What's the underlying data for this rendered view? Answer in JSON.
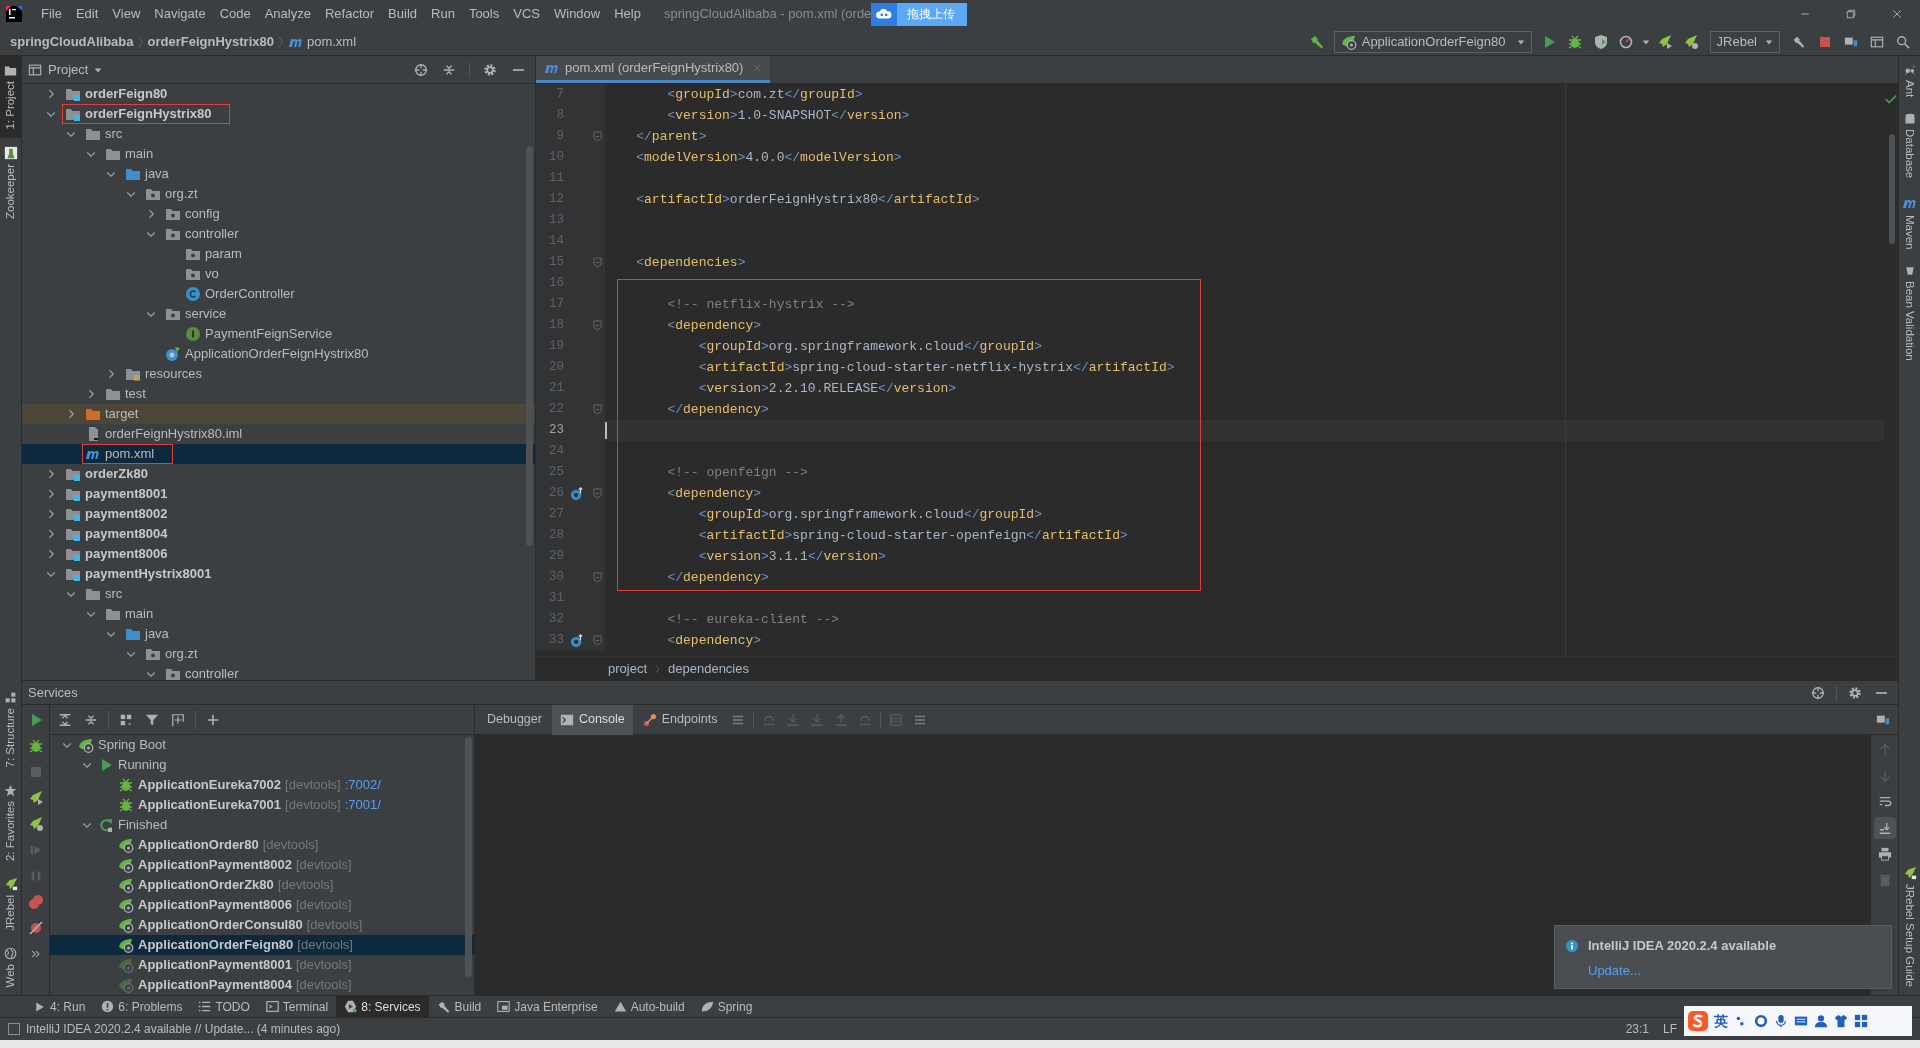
{
  "menu_bar": {
    "items": [
      "File",
      "Edit",
      "View",
      "Navigate",
      "Code",
      "Analyze",
      "Refactor",
      "Build",
      "Run",
      "Tools",
      "VCS",
      "Window",
      "Help"
    ],
    "window_title": "springCloudAlibaba - pom.xml (orde",
    "upload_button": "拖拽上传"
  },
  "nav_bar": {
    "breadcrumbs": [
      {
        "label": "springCloudAlibaba",
        "kind": "project"
      },
      {
        "label": "orderFeignHystrix80",
        "kind": "module"
      },
      {
        "label": "pom.xml",
        "kind": "maven"
      }
    ],
    "run_configuration": "ApplicationOrderFeign80",
    "jrebel_menu": "JRebel"
  },
  "left_strip": {
    "top": [
      {
        "label": "1: Project",
        "selected": true
      },
      {
        "label": "Zookeeper",
        "selected": false
      }
    ],
    "bottom": [
      {
        "label": "7: Structure",
        "selected": false
      },
      {
        "label": "2: Favorites",
        "selected": false
      },
      {
        "label": "JRebel",
        "selected": false
      },
      {
        "label": "Web",
        "selected": false
      }
    ]
  },
  "right_strip": {
    "top": [
      "Ant",
      "Database",
      "Maven",
      "Bean Validation"
    ],
    "bottom": [
      "JRebel Setup Guide"
    ]
  },
  "project": {
    "title": "Project",
    "tree": [
      {
        "label": "orderFeign80",
        "kind": "module",
        "expanded": false,
        "selected": false,
        "outlined": false
      },
      {
        "label": "orderFeignHystrix80",
        "kind": "module",
        "expanded": true,
        "selected": false,
        "outlined": true,
        "children": [
          {
            "label": "src",
            "kind": "folder",
            "expanded": true,
            "selected": false,
            "outlined": false,
            "children": [
              {
                "label": "main",
                "kind": "folder",
                "expanded": true,
                "selected": false,
                "outlined": false,
                "children": [
                  {
                    "label": "java",
                    "kind": "source-folder",
                    "expanded": true,
                    "selected": false,
                    "outlined": false,
                    "children": [
                      {
                        "label": "org.zt",
                        "kind": "package",
                        "expanded": true,
                        "selected": false,
                        "outlined": false,
                        "children": [
                          {
                            "label": "config",
                            "kind": "package",
                            "expanded": false,
                            "selected": false,
                            "outlined": false
                          },
                          {
                            "label": "controller",
                            "kind": "package",
                            "expanded": true,
                            "selected": false,
                            "outlined": false,
                            "children": [
                              {
                                "label": "param",
                                "kind": "package",
                                "selected": false,
                                "outlined": false
                              },
                              {
                                "label": "vo",
                                "kind": "package",
                                "selected": false,
                                "outlined": false
                              },
                              {
                                "label": "OrderController",
                                "kind": "class",
                                "selected": false,
                                "outlined": false
                              }
                            ]
                          },
                          {
                            "label": "service",
                            "kind": "package",
                            "expanded": true,
                            "selected": false,
                            "outlined": false,
                            "children": [
                              {
                                "label": "PaymentFeignService",
                                "kind": "interface",
                                "selected": false,
                                "outlined": false
                              }
                            ]
                          },
                          {
                            "label": "ApplicationOrderFeignHystrix80",
                            "kind": "spring-app",
                            "selected": false,
                            "outlined": false
                          }
                        ]
                      }
                    ]
                  },
                  {
                    "label": "resources",
                    "kind": "resources",
                    "expanded": false,
                    "selected": false,
                    "outlined": false
                  }
                ]
              },
              {
                "label": "test",
                "kind": "folder",
                "expanded": false,
                "selected": false,
                "outlined": false
              }
            ]
          },
          {
            "label": "target",
            "kind": "excluded",
            "expanded": false,
            "selected": false,
            "outlined": false
          },
          {
            "label": "orderFeignHystrix80.iml",
            "kind": "iml",
            "selected": false,
            "outlined": false
          },
          {
            "label": "pom.xml",
            "kind": "maven",
            "selected": true,
            "outlined": true
          }
        ]
      },
      {
        "label": "orderZk80",
        "kind": "module",
        "expanded": false,
        "selected": false,
        "outlined": false
      },
      {
        "label": "payment8001",
        "kind": "module",
        "expanded": false,
        "selected": false,
        "outlined": false
      },
      {
        "label": "payment8002",
        "kind": "module",
        "expanded": false,
        "selected": false,
        "outlined": false
      },
      {
        "label": "payment8004",
        "kind": "module",
        "expanded": false,
        "selected": false,
        "outlined": false
      },
      {
        "label": "payment8006",
        "kind": "module",
        "expanded": false,
        "selected": false,
        "outlined": false
      },
      {
        "label": "paymentHystrix8001",
        "kind": "module",
        "expanded": true,
        "selected": false,
        "outlined": false,
        "children": [
          {
            "label": "src",
            "kind": "folder",
            "expanded": true,
            "selected": false,
            "outlined": false,
            "children": [
              {
                "label": "main",
                "kind": "folder",
                "expanded": true,
                "selected": false,
                "outlined": false,
                "children": [
                  {
                    "label": "java",
                    "kind": "source-folder",
                    "expanded": true,
                    "selected": false,
                    "outlined": false,
                    "children": [
                      {
                        "label": "org.zt",
                        "kind": "package",
                        "expanded": true,
                        "selected": false,
                        "outlined": false,
                        "children": [
                          {
                            "label": "controller",
                            "kind": "package",
                            "expanded": true,
                            "selected": false,
                            "outlined": false
                          }
                        ]
                      }
                    ]
                  }
                ]
              }
            ]
          }
        ]
      }
    ]
  },
  "editor": {
    "tab": "pom.xml (orderFeignHystrix80)",
    "blocks": [
      {
        "boxed": false,
        "lines": [
          {
            "number": "7",
            "code": "        <groupId>com.zt</groupId>",
            "fold": false,
            "marker": false,
            "current": false
          },
          {
            "number": "8",
            "code": "        <version>1.0-SNAPSHOT</version>",
            "fold": false,
            "marker": false,
            "current": false
          },
          {
            "number": "9",
            "code": "    </parent>",
            "fold": true,
            "marker": false,
            "current": false
          },
          {
            "number": "10",
            "code": "    <modelVersion>4.0.0</modelVersion>",
            "fold": false,
            "marker": false,
            "current": false
          },
          {
            "number": "11",
            "fold": false,
            "marker": false,
            "current": false
          },
          {
            "number": "12",
            "code": "    <artifactId>orderFeignHystrix80</artifactId>",
            "fold": false,
            "marker": false,
            "current": false
          },
          {
            "number": "13",
            "fold": false,
            "marker": false,
            "current": false
          },
          {
            "number": "14",
            "fold": false,
            "marker": false,
            "current": false
          },
          {
            "number": "15",
            "code": "    <dependencies>",
            "fold": true,
            "marker": false,
            "current": false
          }
        ]
      },
      {
        "boxed": true,
        "lines": [
          {
            "number": "16",
            "fold": false,
            "marker": false,
            "current": false
          },
          {
            "number": "17",
            "code": "        <!-- netflix-hystrix -->",
            "fold": false,
            "marker": false,
            "current": false
          },
          {
            "number": "18",
            "code": "        <dependency>",
            "fold": true,
            "marker": false,
            "current": false
          },
          {
            "number": "19",
            "code": "            <groupId>org.springframework.cloud</groupId>",
            "fold": false,
            "marker": false,
            "current": false
          },
          {
            "number": "20",
            "code": "            <artifactId>spring-cloud-starter-netflix-hystrix</artifactId>",
            "fold": false,
            "marker": false,
            "current": false
          },
          {
            "number": "21",
            "code": "            <version>2.2.10.RELEASE</version>",
            "fold": false,
            "marker": false,
            "current": false
          },
          {
            "number": "22",
            "code": "        </dependency>",
            "fold": true,
            "marker": false,
            "current": false
          },
          {
            "number": "23",
            "fold": false,
            "marker": false,
            "current": true
          },
          {
            "number": "24",
            "fold": false,
            "marker": false,
            "current": false
          },
          {
            "number": "25",
            "code": "        <!-- openfeign -->",
            "fold": false,
            "marker": false,
            "current": false
          },
          {
            "number": "26",
            "code": "        <dependency>",
            "fold": true,
            "marker": true,
            "current": false
          },
          {
            "number": "27",
            "code": "            <groupId>org.springframework.cloud</groupId>",
            "fold": false,
            "marker": false,
            "current": false
          },
          {
            "number": "28",
            "code": "            <artifactId>spring-cloud-starter-openfeign</artifactId>",
            "fold": false,
            "marker": false,
            "current": false
          },
          {
            "number": "29",
            "code": "            <version>3.1.1</version>",
            "fold": false,
            "marker": false,
            "current": false
          },
          {
            "number": "30",
            "code": "        </dependency>",
            "fold": true,
            "marker": false,
            "current": false
          }
        ]
      },
      {
        "boxed": false,
        "lines": [
          {
            "number": "31",
            "fold": false,
            "marker": false,
            "current": false
          },
          {
            "number": "32",
            "code": "        <!-- eureka-client -->",
            "fold": false,
            "marker": false,
            "current": false
          },
          {
            "number": "33",
            "code": "        <dependency>",
            "fold": true,
            "marker": true,
            "current": false
          }
        ]
      }
    ],
    "breadcrumbs": [
      "project",
      "dependencies"
    ]
  },
  "services": {
    "title": "Services",
    "tree": [
      {
        "label": "Spring Boot",
        "kind": "spring-boot",
        "expanded": true,
        "selected": false,
        "children": [
          {
            "label": "Running",
            "kind": "running",
            "expanded": true,
            "selected": false,
            "children": [
              {
                "label": "ApplicationEureka7002",
                "kind": "debugging",
                "tag": "[devtools]",
                "port": ":7002/",
                "selected": false
              },
              {
                "label": "ApplicationEureka7001",
                "kind": "debugging",
                "tag": "[devtools]",
                "port": ":7001/",
                "selected": false
              }
            ]
          },
          {
            "label": "Finished",
            "kind": "finished",
            "expanded": true,
            "selected": false,
            "children": [
              {
                "label": "ApplicationOrder80",
                "kind": "app",
                "tag": "[devtools]",
                "selected": false
              },
              {
                "label": "ApplicationPayment8002",
                "kind": "app",
                "tag": "[devtools]",
                "selected": false
              },
              {
                "label": "ApplicationOrderZk80",
                "kind": "app",
                "tag": "[devtools]",
                "selected": false
              },
              {
                "label": "ApplicationPayment8006",
                "kind": "app",
                "tag": "[devtools]",
                "selected": false
              },
              {
                "label": "ApplicationOrderConsul80",
                "kind": "app",
                "tag": "[devtools]",
                "selected": false
              },
              {
                "label": "ApplicationOrderFeign80",
                "kind": "app",
                "tag": "[devtools]",
                "selected": true
              },
              {
                "label": "ApplicationPayment8001",
                "kind": "app-idle",
                "tag": "[devtools]",
                "selected": false
              },
              {
                "label": "ApplicationPayment8004",
                "kind": "app-idle",
                "tag": "[devtools]",
                "selected": false
              }
            ]
          }
        ]
      }
    ],
    "tabs": [
      {
        "label": "Debugger",
        "kind": "debugger",
        "selected": false
      },
      {
        "label": "Console",
        "kind": "console",
        "selected": true
      },
      {
        "label": "Endpoints",
        "kind": "endpoints",
        "selected": false
      }
    ]
  },
  "notification": {
    "title": "IntelliJ IDEA 2020.2.4 available",
    "link": "Update..."
  },
  "tool_tabs": [
    {
      "label": "4: Run",
      "kind": "run",
      "selected": false
    },
    {
      "label": "6: Problems",
      "kind": "problems",
      "selected": false
    },
    {
      "label": "TODO",
      "kind": "todo",
      "selected": false
    },
    {
      "label": "Terminal",
      "kind": "terminal",
      "selected": false
    },
    {
      "label": "8: Services",
      "kind": "services",
      "selected": true
    },
    {
      "label": "Build",
      "kind": "build",
      "selected": false
    },
    {
      "label": "Java Enterprise",
      "kind": "java-ee",
      "selected": false
    },
    {
      "label": "Auto-build",
      "kind": "auto-build",
      "selected": false
    },
    {
      "label": "Spring",
      "kind": "spring",
      "selected": false
    }
  ],
  "status_bar": {
    "message": "IntelliJ IDEA 2020.2.4 available // Update... (4 minutes ago)",
    "position": "23:1",
    "line_separator": "LF"
  },
  "ime_bar": {
    "mode": "英"
  }
}
